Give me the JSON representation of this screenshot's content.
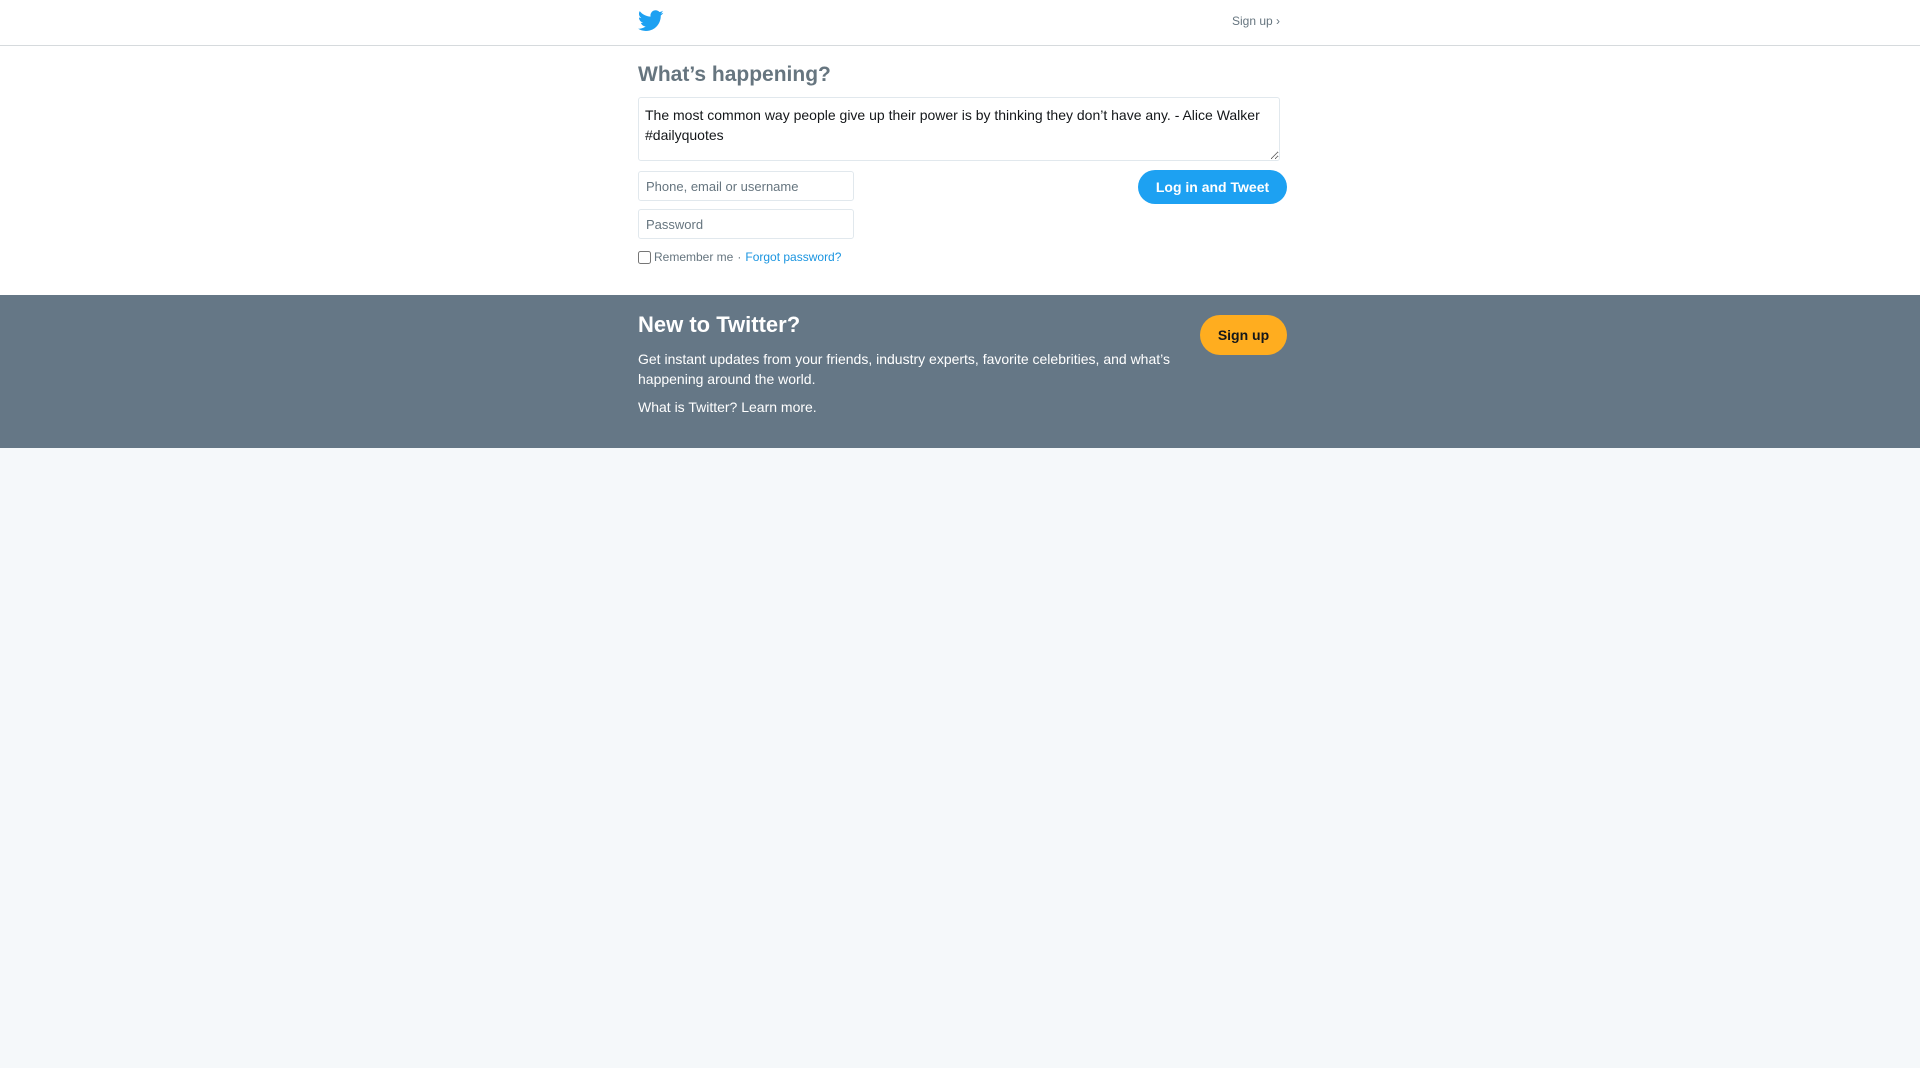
{
  "header": {
    "logo_icon": "twitter-bird-icon",
    "signup_link": "Sign up ›"
  },
  "compose": {
    "title": "What’s happening?",
    "tweet_text": "The most common way people give up their power is by thinking they don’t have any. - Alice Walker #dailyquotes",
    "username_placeholder": "Phone, email or username",
    "password_placeholder": "Password",
    "remember_label": "Remember me",
    "separator": "·",
    "forgot_password": "Forgot password?",
    "submit_label": "Log in and Tweet"
  },
  "banner": {
    "title": "New to Twitter?",
    "description": "Get instant updates from your friends, industry experts, favorite celebrities, and what’s happening around the world.",
    "learn_more": "What is Twitter? Learn more.",
    "signup_label": "Sign up"
  },
  "colors": {
    "brand_blue": "#1da1f2",
    "banner_gray": "#657786",
    "signup_yellow": "#ffad1f",
    "page_bg": "#f5f8fa"
  }
}
